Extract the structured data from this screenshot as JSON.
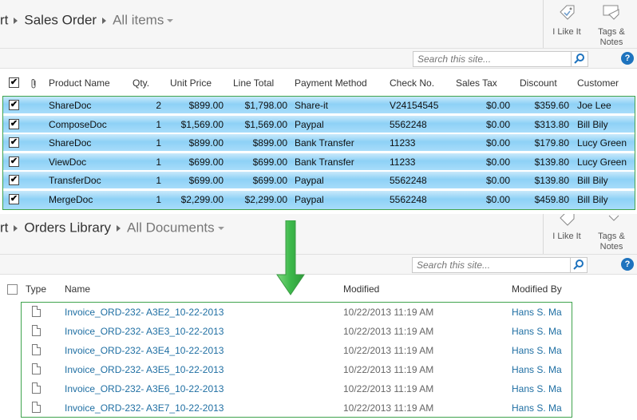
{
  "top": {
    "breadcrumb": {
      "prefix": "rt",
      "list": "Sales Order",
      "view": "All items"
    },
    "ribbon": {
      "like_label": "I Like It",
      "tags_label_1": "Tags &",
      "tags_label_2": "Notes"
    },
    "search": {
      "placeholder": "Search this site..."
    },
    "help": "?",
    "columns": [
      "Product Name",
      "Qty.",
      "Unit Price",
      "Line Total",
      "Payment Method",
      "Check No.",
      "Sales Tax",
      "Discount",
      "Customer"
    ],
    "rows": [
      {
        "product": "ShareDoc",
        "qty": "2",
        "unit_price": "$899.00",
        "line_total": "$1,798.00",
        "payment": "Share-it",
        "check": "V24154545",
        "tax": "$0.00",
        "discount": "$359.60",
        "customer": "Joe Lee"
      },
      {
        "product": "ComposeDoc",
        "qty": "1",
        "unit_price": "$1,569.00",
        "line_total": "$1,569.00",
        "payment": "Paypal",
        "check": "5562248",
        "tax": "$0.00",
        "discount": "$313.80",
        "customer": "Bill Bily"
      },
      {
        "product": "ShareDoc",
        "qty": "1",
        "unit_price": "$899.00",
        "line_total": "$899.00",
        "payment": "Bank Transfer",
        "check": "11233",
        "tax": "$0.00",
        "discount": "$179.80",
        "customer": "Lucy Green"
      },
      {
        "product": "ViewDoc",
        "qty": "1",
        "unit_price": "$699.00",
        "line_total": "$699.00",
        "payment": "Bank Transfer",
        "check": "11233",
        "tax": "$0.00",
        "discount": "$139.80",
        "customer": "Lucy Green"
      },
      {
        "product": "TransferDoc",
        "qty": "1",
        "unit_price": "$699.00",
        "line_total": "$699.00",
        "payment": "Paypal",
        "check": "5562248",
        "tax": "$0.00",
        "discount": "$139.80",
        "customer": "Bill Bily"
      },
      {
        "product": "MergeDoc",
        "qty": "1",
        "unit_price": "$2,299.00",
        "line_total": "$2,299.00",
        "payment": "Paypal",
        "check": "5562248",
        "tax": "$0.00",
        "discount": "$459.80",
        "customer": "Bill Bily"
      }
    ]
  },
  "bottom": {
    "breadcrumb": {
      "prefix": "rt",
      "list": "Orders Library",
      "view": "All Documents"
    },
    "ribbon": {
      "like_label": "I Like It",
      "tags_label_1": "Tags &",
      "tags_label_2": "Notes"
    },
    "search": {
      "placeholder": "Search this site..."
    },
    "help": "?",
    "columns": [
      "Type",
      "Name",
      "Modified",
      "Modified By"
    ],
    "rows": [
      {
        "name": "Invoice_ORD-232- A3E2_10-22-2013",
        "modified": "10/22/2013 11:19 AM",
        "modified_by": "Hans S. Ma"
      },
      {
        "name": "Invoice_ORD-232- A3E3_10-22-2013",
        "modified": "10/22/2013 11:19 AM",
        "modified_by": "Hans S. Ma"
      },
      {
        "name": "Invoice_ORD-232- A3E4_10-22-2013",
        "modified": "10/22/2013 11:19 AM",
        "modified_by": "Hans S. Ma"
      },
      {
        "name": "Invoice_ORD-232- A3E5_10-22-2013",
        "modified": "10/22/2013 11:19 AM",
        "modified_by": "Hans S. Ma"
      },
      {
        "name": "Invoice_ORD-232- A3E6_10-22-2013",
        "modified": "10/22/2013 11:19 AM",
        "modified_by": "Hans S. Ma"
      },
      {
        "name": "Invoice_ORD-232- A3E7_10-22-2013",
        "modified": "10/22/2013 11:19 AM",
        "modified_by": "Hans S. Ma"
      }
    ]
  },
  "icons": {
    "checkbox_mark": "✔",
    "paperclip": "attachment-icon",
    "arrow": "down-arrow-icon",
    "search": "magnifier-icon",
    "tag": "tag-icon"
  },
  "colors": {
    "selected_row": "#8ed1f6",
    "highlight_border": "#3fa34d",
    "link": "#1f6fa3",
    "help": "#1e73be"
  }
}
